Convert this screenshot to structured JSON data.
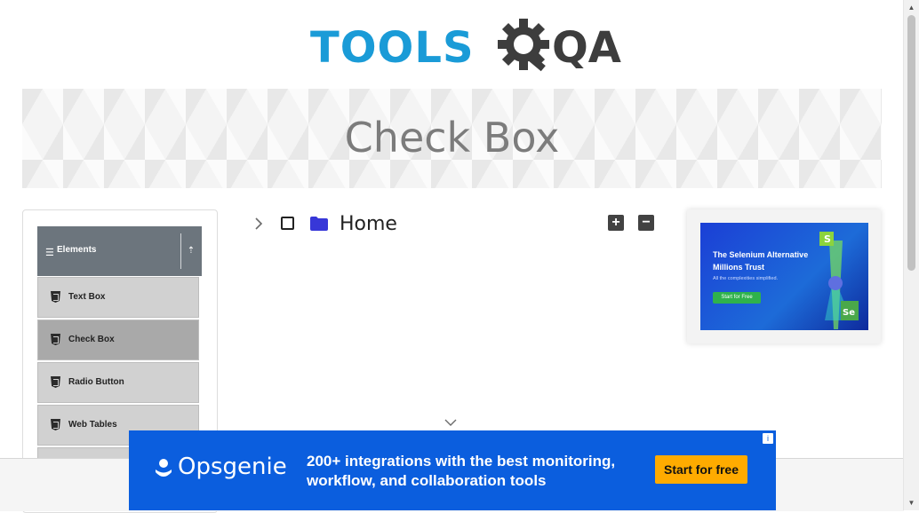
{
  "header": {
    "logo_text_left": "TOOLS",
    "logo_text_right": "QA",
    "colors": {
      "tools": "#1a9bd7",
      "qa": "#3d3d3d"
    }
  },
  "page": {
    "title": "Check Box"
  },
  "sidebar": {
    "group_title": "Elements",
    "items": [
      {
        "label": "Text Box",
        "icon": "html5-icon"
      },
      {
        "label": "Check Box",
        "icon": "html5-icon",
        "active": true
      },
      {
        "label": "Radio Button",
        "icon": "html5-icon"
      },
      {
        "label": "Web Tables",
        "icon": "html5-icon"
      }
    ]
  },
  "tree": {
    "root_label": "Home",
    "expand_all_icon": "plus-square-icon",
    "collapse_all_icon": "minus-square-icon",
    "folder_color": "#3737d8"
  },
  "ad_right": {
    "headline": "The Selenium Alternative Millions Trust",
    "subtext": "All the complexities simplified.",
    "cta": "Start for Free"
  },
  "ad_bottom": {
    "brand": "Opsgenie",
    "message": "200+ integrations with the best monitoring, workflow, and collaboration tools",
    "cta": "Start for free",
    "colors": {
      "background": "#0b5ede",
      "cta": "#ffab00"
    }
  }
}
